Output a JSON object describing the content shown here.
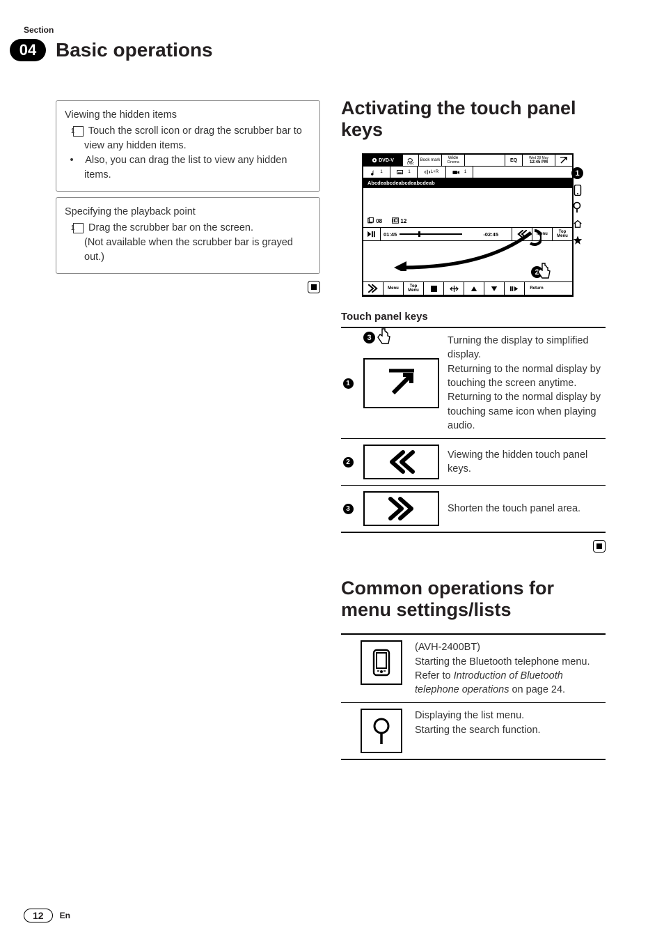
{
  "header": {
    "section_label": "Section",
    "chapter_number": "04",
    "chapter_title": "Basic operations"
  },
  "left": {
    "card1": {
      "title": "Viewing the hidden items",
      "step1": "Touch the scroll icon or drag the scrubber bar to view any hidden items.",
      "bullet": "Also, you can drag the list to view any hidden items."
    },
    "card2": {
      "title": "Specifying the playback point",
      "step1": "Drag the scrubber bar on the screen.",
      "note": "(Not available when the scrubber bar is grayed out.)"
    }
  },
  "right": {
    "h_activating": "Activating the touch panel keys",
    "figure": {
      "dvd": "DVD-V",
      "book": "Book mark",
      "wide": "Wide",
      "cinema": "Cinema",
      "eq": "EQ",
      "date": "Wed 28 May",
      "time": "12:45 PM",
      "sub_one": "1",
      "lr": "L+R",
      "file_title": "Abcdeabcdeabcdeabcdeab",
      "track": "08",
      "chapter": "12",
      "elapsed": "01:45",
      "remain": "-02:45",
      "menu": "Menu",
      "topmenu_a": "Top",
      "topmenu_b": "Menu",
      "return": "Return"
    },
    "tp_heading": "Touch panel keys",
    "tp1": "Turning the display to simplified display.\nReturning to the normal display by touching the screen anytime.\nReturning to the normal display by touching same icon when playing audio.",
    "tp2": "Viewing the hidden touch panel keys.",
    "tp3": "Shorten the touch panel area.",
    "h_common": "Common operations for menu settings/lists",
    "co1_model": "(AVH-2400BT)",
    "co1_a": "Starting the Bluetooth telephone menu.",
    "co1_b": "Refer to ",
    "co1_italic": "Introduction of Bluetooth telephone operations",
    "co1_c": " on page 24.",
    "co2_a": "Displaying the list menu.",
    "co2_b": "Starting the search function."
  },
  "footer": {
    "page": "12",
    "lang": "En"
  }
}
